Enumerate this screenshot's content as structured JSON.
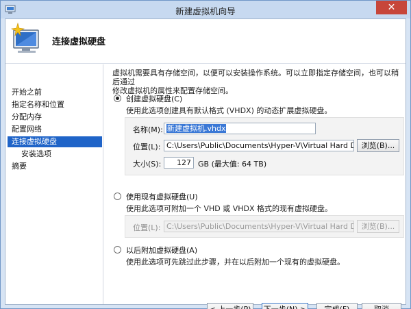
{
  "window": {
    "title": "新建虚拟机向导",
    "close_glyph": "✕"
  },
  "header": {
    "title": "连接虚拟硬盘",
    "icon": "computer-sparkle-icon"
  },
  "nav": {
    "items": [
      {
        "label": "开始之前",
        "active": false,
        "sub": false
      },
      {
        "label": "指定名称和位置",
        "active": false,
        "sub": false
      },
      {
        "label": "分配内存",
        "active": false,
        "sub": false
      },
      {
        "label": "配置网络",
        "active": false,
        "sub": false
      },
      {
        "label": "连接虚拟硬盘",
        "active": true,
        "sub": false
      },
      {
        "label": "安装选项",
        "active": false,
        "sub": true
      },
      {
        "label": "摘要",
        "active": false,
        "sub": false
      }
    ]
  },
  "content": {
    "description_line1": "虚拟机需要具有存储空间，以便可以安装操作系统。可以立即指定存储空间，也可以稍后通过",
    "description_line2": "修改虚拟机的属性来配置存储空间。",
    "create": {
      "label": "创建虚拟硬盘(C)",
      "checked": true,
      "description": "使用此选项创建具有默认格式 (VHDX) 的动态扩展虚拟硬盘。",
      "name_label": "名称(M):",
      "name_value": "新建虚拟机.vhdx",
      "location_label": "位置(L):",
      "location_value": "C:\\Users\\Public\\Documents\\Hyper-V\\Virtual Hard Disks\\",
      "browse_label": "浏览(B)...",
      "size_label": "大小(S):",
      "size_value": "127",
      "size_unit": "GB (最大值: 64 TB)"
    },
    "existing": {
      "label": "使用现有虚拟硬盘(U)",
      "checked": false,
      "description": "使用此选项可附加一个 VHD 或 VHDX 格式的现有虚拟硬盘。",
      "location_label": "位置(L):",
      "location_value": "C:\\Users\\Public\\Documents\\Hyper-V\\Virtual Hard Disks\\",
      "browse_label": "浏览(B)..."
    },
    "later": {
      "label": "以后附加虚拟硬盘(A)",
      "checked": false,
      "description": "使用此选项可先跳过此步骤，并在以后附加一个现有的虚拟硬盘。"
    }
  },
  "footer": {
    "prev_label": "< 上一步(P)",
    "next_label": "下一步(N) >",
    "finish_label": "完成(F)",
    "cancel_label": "取消"
  }
}
